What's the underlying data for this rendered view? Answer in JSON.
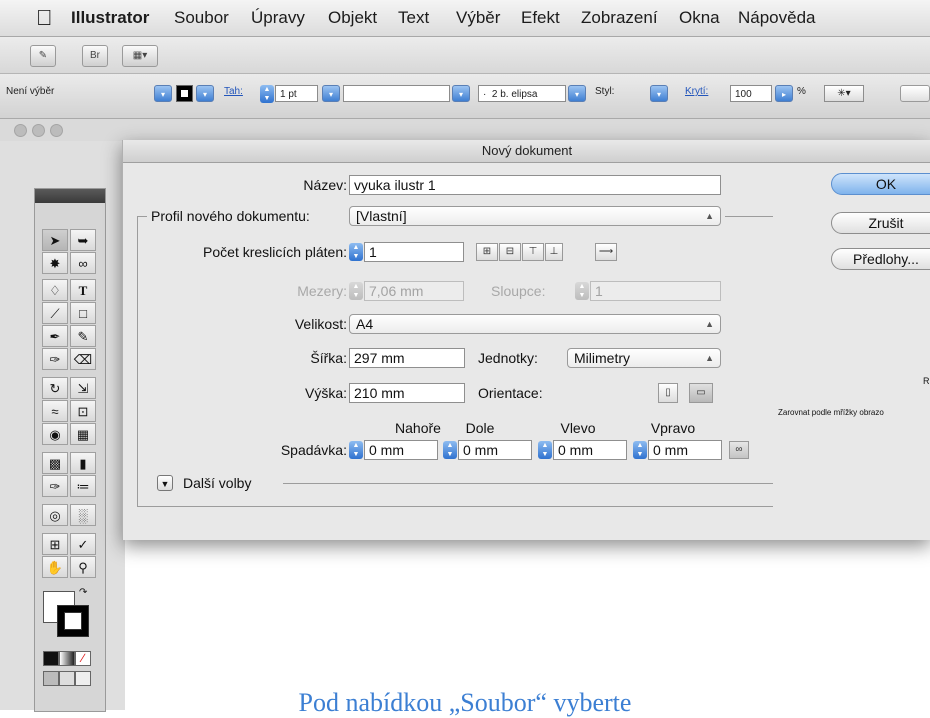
{
  "menubar": {
    "apple_icon": "apple-icon",
    "items": [
      "Illustrator",
      "Soubor",
      "Úpravy",
      "Objekt",
      "Text",
      "Výběr",
      "Efekt",
      "Zobrazení",
      "Okna",
      "Nápověda"
    ]
  },
  "appbar": {
    "bridge_label": "Br",
    "arrange_label": "▾"
  },
  "controlbar": {
    "selection_status": "Není výběr",
    "stroke_label": "Tah:",
    "stroke_value": "1 pt",
    "brush_value": "2 b. elipsa",
    "style_label": "Styl:",
    "opacity_label": "Krytí:",
    "opacity_value": "100",
    "percent": "%"
  },
  "dialog": {
    "title": "Nový dokument",
    "name_label": "Název:",
    "name_value": "vyuka ilustr 1",
    "profile_label": "Profil nového dokumentu:",
    "profile_value": "[Vlastní]",
    "artboards_label": "Počet kreslicích pláten:",
    "artboards_value": "1",
    "spacing_label": "Mezery:",
    "spacing_value": "7,06 mm",
    "columns_label": "Sloupce:",
    "columns_value": "1",
    "size_label": "Velikost:",
    "size_value": "A4",
    "width_label": "Šířka:",
    "width_value": "297 mm",
    "units_label": "Jednotky:",
    "units_value": "Milimetry",
    "height_label": "Výška:",
    "height_value": "210 mm",
    "orientation_label": "Orientace:",
    "bleed_label": "Spadávka:",
    "bleed_top_label": "Nahoře",
    "bleed_bottom_label": "Dole",
    "bleed_left_label": "Vlevo",
    "bleed_right_label": "Vpravo",
    "bleed_top_value": "0 mm",
    "bleed_bottom_value": "0 mm",
    "bleed_left_value": "0 mm",
    "bleed_right_value": "0 mm",
    "more_options_label": "Další volby",
    "ok_label": "OK",
    "cancel_label": "Zrušit",
    "templates_label": "Předlohy...",
    "side_text_r": "R",
    "side_text_align": "Zarovnat podle mřížky obrazo"
  },
  "caption": "Pod nabídkou „Soubor“ vyberte"
}
